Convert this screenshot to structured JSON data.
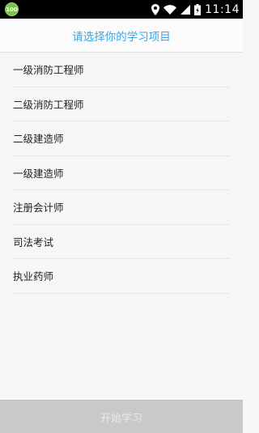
{
  "status_bar": {
    "battery_level": "100",
    "time": "11:14",
    "icons": [
      "location-icon",
      "wifi-icon",
      "signal-icon",
      "battery-icon"
    ]
  },
  "header": {
    "title": "请选择你的学习项目"
  },
  "list": {
    "items": [
      {
        "label": "一级消防工程师"
      },
      {
        "label": "二级消防工程师"
      },
      {
        "label": "二级建造师"
      },
      {
        "label": "一级建造师"
      },
      {
        "label": "注册会计师"
      },
      {
        "label": "司法考试"
      },
      {
        "label": "执业药师"
      }
    ]
  },
  "footer": {
    "start_label": "开始学习"
  },
  "colors": {
    "accent": "#3aa6e6",
    "button_bg": "#c9c9c9",
    "battery_badge": "#7dc24b"
  }
}
